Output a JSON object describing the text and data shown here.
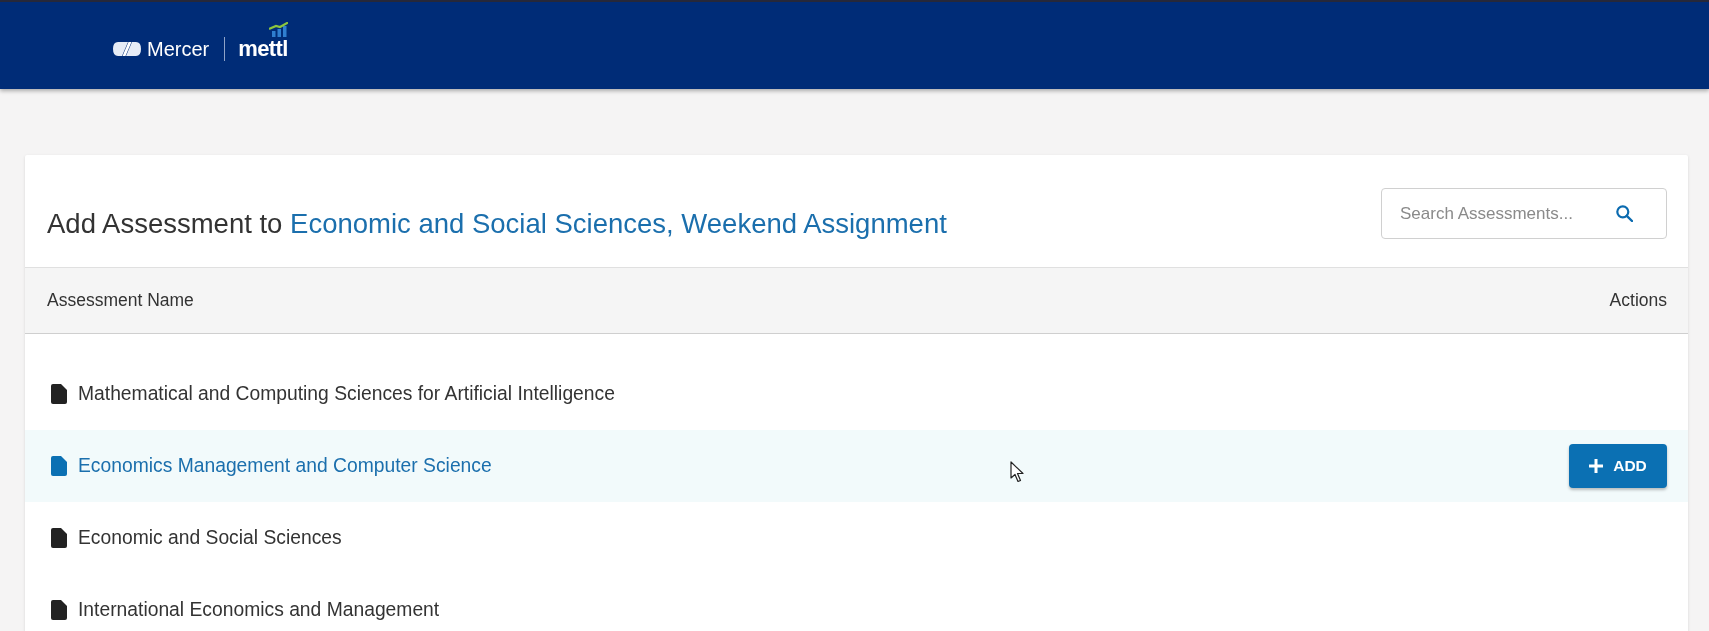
{
  "header": {
    "brand": "Mercer",
    "product": "mettl"
  },
  "panel": {
    "title": {
      "prefix": "Add Assessment to",
      "link": "Economic and Social Sciences, Weekend Assignment"
    },
    "search": {
      "placeholder": "Search Assessments..."
    }
  },
  "table": {
    "columns": [
      "Assessment Name",
      "Actions"
    ],
    "rows": [
      {
        "name": "Mathematical and Computing Sciences for Artificial Intelligence",
        "hovered": false
      },
      {
        "name": "Economics Management and Computer Science",
        "hovered": true,
        "action": "ADD"
      },
      {
        "name": "Economic and Social Sciences",
        "hovered": false
      },
      {
        "name": "International Economics and Management",
        "hovered": false
      }
    ]
  }
}
